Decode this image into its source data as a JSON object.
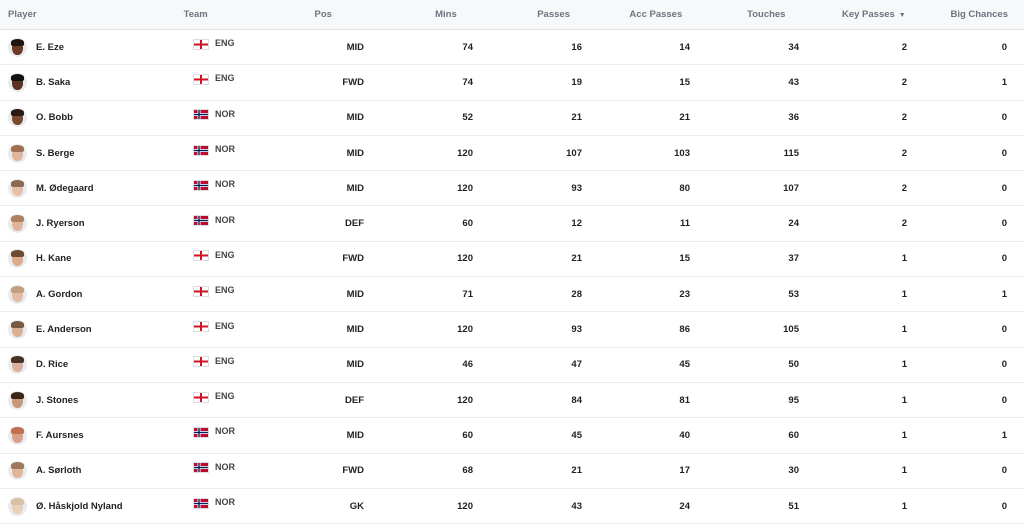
{
  "header": {
    "player": "Player",
    "team": "Team",
    "pos": "Pos",
    "mins": "Mins",
    "passes": "Passes",
    "acc_passes": "Acc Passes",
    "touches": "Touches",
    "key_passes": "Key Passes",
    "big_chances": "Big Chances",
    "sort_indicator": "▼"
  },
  "colors": {
    "eng_red": "#ce1124",
    "nor_red": "#ba0c2f",
    "nor_blue": "#00205b"
  },
  "rows": [
    {
      "name": "E. Eze",
      "team": "ENG",
      "pos": "MID",
      "mins": "74",
      "passes": "16",
      "acc": "14",
      "touches": "34",
      "key": "2",
      "big": "0",
      "skin": "#6b3a24",
      "hair": "#1f1410"
    },
    {
      "name": "B. Saka",
      "team": "ENG",
      "pos": "FWD",
      "mins": "74",
      "passes": "19",
      "acc": "15",
      "touches": "43",
      "key": "2",
      "big": "1",
      "skin": "#5a3322",
      "hair": "#151010"
    },
    {
      "name": "O. Bobb",
      "team": "NOR",
      "pos": "MID",
      "mins": "52",
      "passes": "21",
      "acc": "21",
      "touches": "36",
      "key": "2",
      "big": "0",
      "skin": "#7a4a2e",
      "hair": "#2a1a12"
    },
    {
      "name": "S. Berge",
      "team": "NOR",
      "pos": "MID",
      "mins": "120",
      "passes": "107",
      "acc": "103",
      "touches": "115",
      "key": "2",
      "big": "0",
      "skin": "#e2b69a",
      "hair": "#a07050"
    },
    {
      "name": "M. Ødegaard",
      "team": "NOR",
      "pos": "MID",
      "mins": "120",
      "passes": "93",
      "acc": "80",
      "touches": "107",
      "key": "2",
      "big": "0",
      "skin": "#e6c0a6",
      "hair": "#8a6a50"
    },
    {
      "name": "J. Ryerson",
      "team": "NOR",
      "pos": "DEF",
      "mins": "60",
      "passes": "12",
      "acc": "11",
      "touches": "24",
      "key": "2",
      "big": "0",
      "skin": "#e0b49a",
      "hair": "#b08060"
    },
    {
      "name": "H. Kane",
      "team": "ENG",
      "pos": "FWD",
      "mins": "120",
      "passes": "21",
      "acc": "15",
      "touches": "37",
      "key": "1",
      "big": "0",
      "skin": "#dcaa8c",
      "hair": "#6a4a32"
    },
    {
      "name": "A. Gordon",
      "team": "ENG",
      "pos": "MID",
      "mins": "71",
      "passes": "28",
      "acc": "23",
      "touches": "53",
      "key": "1",
      "big": "1",
      "skin": "#e4bca4",
      "hair": "#c0a080"
    },
    {
      "name": "E. Anderson",
      "team": "ENG",
      "pos": "MID",
      "mins": "120",
      "passes": "93",
      "acc": "86",
      "touches": "105",
      "key": "1",
      "big": "0",
      "skin": "#dcae92",
      "hair": "#7a5a40"
    },
    {
      "name": "D. Rice",
      "team": "ENG",
      "pos": "MID",
      "mins": "46",
      "passes": "47",
      "acc": "45",
      "touches": "50",
      "key": "1",
      "big": "0",
      "skin": "#dcb09a",
      "hair": "#4a3224"
    },
    {
      "name": "J. Stones",
      "team": "ENG",
      "pos": "DEF",
      "mins": "120",
      "passes": "84",
      "acc": "81",
      "touches": "95",
      "key": "1",
      "big": "0",
      "skin": "#c9977a",
      "hair": "#3a2618"
    },
    {
      "name": "F. Aursnes",
      "team": "NOR",
      "pos": "MID",
      "mins": "60",
      "passes": "45",
      "acc": "40",
      "touches": "60",
      "key": "1",
      "big": "1",
      "skin": "#d8a088",
      "hair": "#c07050"
    },
    {
      "name": "A. Sørloth",
      "team": "NOR",
      "pos": "FWD",
      "mins": "68",
      "passes": "21",
      "acc": "17",
      "touches": "30",
      "key": "1",
      "big": "0",
      "skin": "#e2b49c",
      "hair": "#9a7a5a"
    },
    {
      "name": "Ø. Håskjold Nyland",
      "team": "NOR",
      "pos": "GK",
      "mins": "120",
      "passes": "43",
      "acc": "24",
      "touches": "51",
      "key": "1",
      "big": "0",
      "skin": "#ead0b8",
      "hair": "#d8c0a0"
    }
  ]
}
